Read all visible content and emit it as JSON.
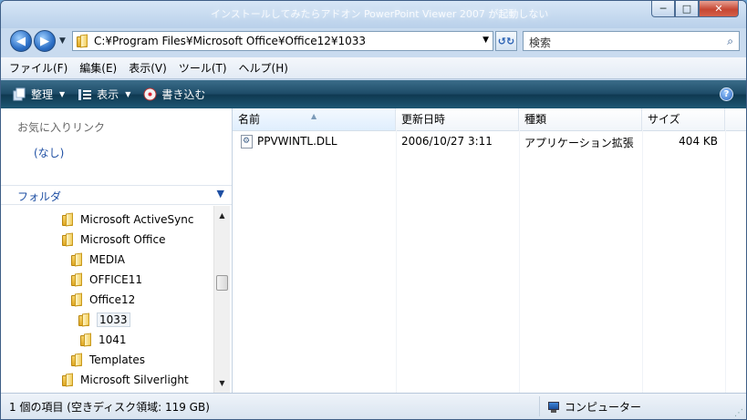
{
  "window": {
    "title": "インストールしてみたらアドオン PowerPoint Viewer 2007 が起動しない"
  },
  "caption": {
    "minimize": "─",
    "maximize": "□",
    "close": "✕"
  },
  "nav": {
    "back": "◀",
    "forward": "▶",
    "drop": "▼"
  },
  "address": {
    "path": "C:¥Program Files¥Microsoft Office¥Office12¥1033",
    "drop": "▼"
  },
  "refresh": {
    "glyph": "↺↻"
  },
  "search": {
    "placeholder": "検索",
    "icon": "⌕"
  },
  "menu": [
    "ファイル(F)",
    "編集(E)",
    "表示(V)",
    "ツール(T)",
    "ヘルプ(H)"
  ],
  "toolbar": {
    "organize": {
      "label": "整理",
      "icon": "organize-icon"
    },
    "views": {
      "label": "表示",
      "icon": "views-icon"
    },
    "burn": {
      "label": "書き込む",
      "icon": "burn-icon"
    },
    "help": "?"
  },
  "favorites": {
    "title": "お気に入りリンク",
    "empty": "(なし)"
  },
  "folders": {
    "title": "フォルダ",
    "items": [
      {
        "label": "Microsoft ActiveSync",
        "depth": 0
      },
      {
        "label": "Microsoft Office",
        "depth": 0
      },
      {
        "label": "MEDIA",
        "depth": 1
      },
      {
        "label": "OFFICE11",
        "depth": 1
      },
      {
        "label": "Office12",
        "depth": 1
      },
      {
        "label": "1033",
        "depth": 2,
        "selected": true
      },
      {
        "label": "1041",
        "depth": 2
      },
      {
        "label": "Templates",
        "depth": 1
      },
      {
        "label": "Microsoft Silverlight",
        "depth": 0
      }
    ]
  },
  "columns": {
    "name": "名前",
    "date": "更新日時",
    "type": "種類",
    "size": "サイズ"
  },
  "files": [
    {
      "name": "PPVWINTL.DLL",
      "date": "2006/10/27 3:11",
      "type": "アプリケーション拡張",
      "size": "404 KB"
    }
  ],
  "status": {
    "text": "1 個の項目 (空きディスク領域: 119 GB)",
    "location": "コンピューター"
  }
}
